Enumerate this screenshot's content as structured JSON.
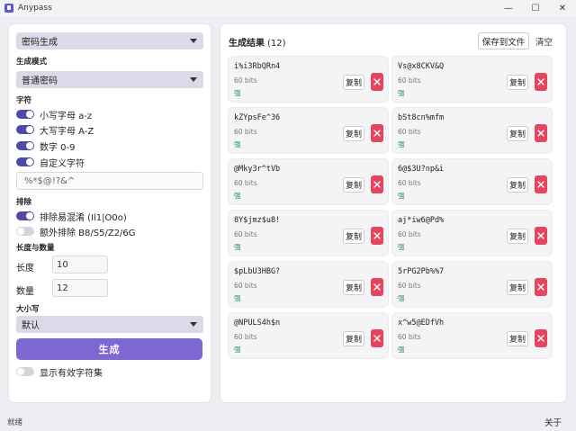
{
  "app": {
    "title": "Anypass"
  },
  "window": {
    "minimize": "—",
    "maximize": "☐",
    "close": "✕"
  },
  "left": {
    "mode_select": "密码生成",
    "gen_mode_label": "生成模式",
    "gen_mode_value": "普通密码",
    "chars_label": "字符",
    "chars": [
      {
        "label": "小写字母 a-z",
        "on": true
      },
      {
        "label": "大写字母 A-Z",
        "on": true
      },
      {
        "label": "数字 0-9",
        "on": true
      },
      {
        "label": "自定义字符",
        "on": true
      }
    ],
    "custom_chars": "%*$@!?&^",
    "exclude_label": "排除",
    "excludes": [
      {
        "label": "排除易混淆 (Il1|O0o)",
        "on": true
      },
      {
        "label": "额外排除 B8/S5/Z2/6G",
        "on": false
      }
    ],
    "length_count_label": "长度与数量",
    "length_label": "长度",
    "length_value": "10",
    "count_label": "数量",
    "count_value": "12",
    "case_label": "大小写",
    "case_value": "默认",
    "generate_label": "生成",
    "show_charset_label": "显示有效字符集",
    "show_charset_on": false
  },
  "results": {
    "title": "生成结果",
    "count": "(12)",
    "save_label": "保存到文件",
    "clear_label": "清空",
    "copy_label": "复制",
    "items": [
      {
        "password": "i%i3RbQRn4",
        "bits": "60 bits",
        "strength": "强"
      },
      {
        "password": "Vs@x8CKV&Q",
        "bits": "60 bits",
        "strength": "强"
      },
      {
        "password": "kZYpsFe^36",
        "bits": "60 bits",
        "strength": "强"
      },
      {
        "password": "bSt8cn%mfm",
        "bits": "60 bits",
        "strength": "强"
      },
      {
        "password": "@Mky3r^tVb",
        "bits": "60 bits",
        "strength": "强"
      },
      {
        "password": "6@$3U?np&i",
        "bits": "60 bits",
        "strength": "强"
      },
      {
        "password": "8Y$jmz$u8!",
        "bits": "60 bits",
        "strength": "强"
      },
      {
        "password": "aj*iw6@Pd%",
        "bits": "60 bits",
        "strength": "强"
      },
      {
        "password": "$pLbU3HBG?",
        "bits": "60 bits",
        "strength": "强"
      },
      {
        "password": "5rPG2Pb%%7",
        "bits": "60 bits",
        "strength": "强"
      },
      {
        "password": "@NPULS4h$n",
        "bits": "60 bits",
        "strength": "强"
      },
      {
        "password": "x^w5@EDfVh",
        "bits": "60 bits",
        "strength": "强"
      }
    ]
  },
  "status": {
    "text": "就绪",
    "about": "关于"
  },
  "colors": {
    "accent": "#7d67d3",
    "toggle_on": "#4f4aa8",
    "delete": "#e4455f",
    "strength": "#2e9a5a"
  }
}
